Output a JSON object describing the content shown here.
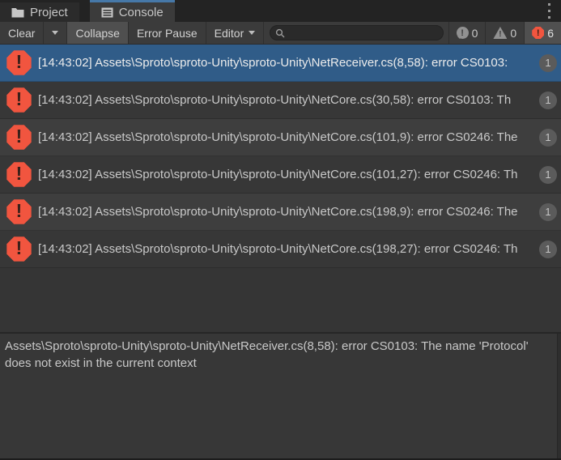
{
  "tabs": [
    {
      "label": "Project",
      "icon": "folder-icon",
      "active": false
    },
    {
      "label": "Console",
      "icon": "console-icon",
      "active": true
    }
  ],
  "toolbar": {
    "clear_label": "Clear",
    "collapse_label": "Collapse",
    "error_pause_label": "Error Pause",
    "editor_label": "Editor",
    "search_value": ""
  },
  "counters": {
    "info_count": "0",
    "warning_count": "0",
    "error_count": "6"
  },
  "console": {
    "selected_index": 0,
    "entries": [
      {
        "text": "[14:43:02] Assets\\Sproto\\sproto-Unity\\sproto-Unity\\NetReceiver.cs(8,58): error CS0103:",
        "count": "1"
      },
      {
        "text": "[14:43:02] Assets\\Sproto\\sproto-Unity\\sproto-Unity\\NetCore.cs(30,58): error CS0103: Th",
        "count": "1"
      },
      {
        "text": "[14:43:02] Assets\\Sproto\\sproto-Unity\\sproto-Unity\\NetCore.cs(101,9): error CS0246: The",
        "count": "1"
      },
      {
        "text": "[14:43:02] Assets\\Sproto\\sproto-Unity\\sproto-Unity\\NetCore.cs(101,27): error CS0246: Th",
        "count": "1"
      },
      {
        "text": "[14:43:02] Assets\\Sproto\\sproto-Unity\\sproto-Unity\\NetCore.cs(198,9): error CS0246: The",
        "count": "1"
      },
      {
        "text": "[14:43:02] Assets\\Sproto\\sproto-Unity\\sproto-Unity\\NetCore.cs(198,27): error CS0246: Th",
        "count": "1"
      }
    ]
  },
  "detail": {
    "text": "Assets\\Sproto\\sproto-Unity\\sproto-Unity\\NetReceiver.cs(8,58): error CS0103: The name 'Protocol' does not exist in the current context"
  },
  "colors": {
    "selection": "#305c88",
    "error_icon": "#f1553f",
    "tab_accent": "#4678a8"
  }
}
